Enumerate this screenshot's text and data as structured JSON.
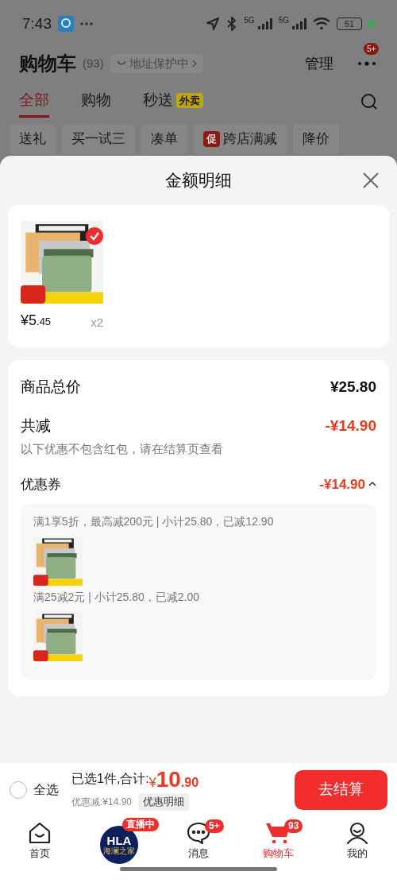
{
  "status_bar": {
    "time": "7:43",
    "network_1": "5G",
    "network_2": "5G",
    "battery": "51"
  },
  "header": {
    "title": "购物车",
    "count": "(93)",
    "address": "地址保护中",
    "manage": "管理",
    "more_badge": "5+"
  },
  "tabs": [
    {
      "label": "全部",
      "selected": true
    },
    {
      "label": "购物",
      "selected": false
    },
    {
      "label": "秒送",
      "tag": "外卖",
      "selected": false
    }
  ],
  "chips": [
    {
      "label": "送礼"
    },
    {
      "label": "买一试三"
    },
    {
      "label": "凑单"
    },
    {
      "label": "跨店满减",
      "tag": "促"
    },
    {
      "label": "降价"
    }
  ],
  "sheet": {
    "title": "金额明细",
    "items": [
      {
        "kind": "picture",
        "checked": true,
        "price_main": "¥5",
        "price_decimal": ".45",
        "qty": "x2"
      }
    ],
    "total": {
      "label": "商品总价",
      "value": "¥25.80"
    },
    "reduction": {
      "label": "共减",
      "value": "-¥14.90",
      "note": "以下优惠不包含红包，请在结算页查看"
    },
    "coupon": {
      "label": "优惠券",
      "value": "-¥14.90",
      "expanded": true
    },
    "coupon_details": [
      {
        "text": "满1享5折，最高减200元 | 小计25.80，已减12.90"
      },
      {
        "text": "满25减2元 | 小计25.80，已减2.00"
      }
    ]
  },
  "footer": {
    "select_all": {
      "label": "全选",
      "checked": false
    },
    "selected_text": "已选1件,合计:",
    "currency": "¥",
    "total_main": "10",
    "total_decimal": ".90",
    "saving": "优惠减:¥14.90",
    "detail_button": "优惠明细",
    "checkout": "去结算"
  },
  "nav": [
    {
      "kind": "home",
      "label": "首页",
      "selected": false
    },
    {
      "kind": "live",
      "badge": "直播中",
      "logo_text": "HLA",
      "logo_subtext": "海澜之家"
    },
    {
      "kind": "message",
      "label": "消息",
      "badge": "5+",
      "selected": false
    },
    {
      "kind": "cart",
      "label": "购物车",
      "badge": "93",
      "selected": true
    },
    {
      "kind": "me",
      "label": "我的",
      "selected": false
    }
  ]
}
